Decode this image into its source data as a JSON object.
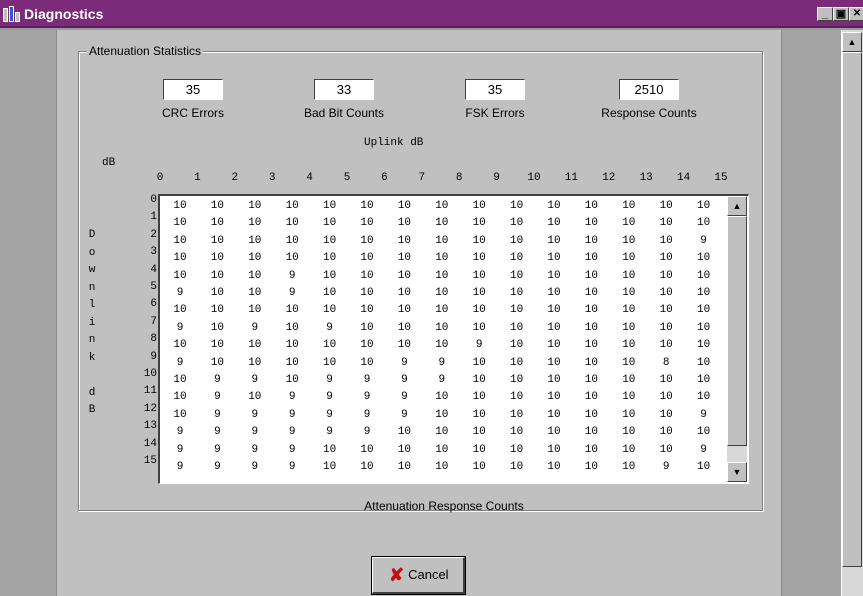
{
  "window": {
    "title": "Diagnostics",
    "minimize": "_",
    "restore": "▣",
    "close": "✕"
  },
  "group": {
    "label": "Attenuation Statistics"
  },
  "stats": [
    {
      "value": "35",
      "label": "CRC Errors"
    },
    {
      "value": "33",
      "label": "Bad Bit Counts"
    },
    {
      "value": "35",
      "label": "FSK Errors"
    },
    {
      "value": "2510",
      "label": "Response Counts"
    }
  ],
  "grid": {
    "uplink_title": "Uplink dB",
    "corner_label": "dB",
    "downlink_title": [
      "D",
      "o",
      "w",
      "n",
      "l",
      "i",
      "n",
      "k",
      "",
      "d",
      "B"
    ],
    "columns": [
      "0",
      "1",
      "2",
      "3",
      "4",
      "5",
      "6",
      "7",
      "8",
      "9",
      "10",
      "11",
      "12",
      "13",
      "14",
      "15"
    ],
    "rows": [
      "0",
      "1",
      "2",
      "3",
      "4",
      "5",
      "6",
      "7",
      "8",
      "9",
      "10",
      "11",
      "12",
      "13",
      "14",
      "15"
    ],
    "cells": [
      [
        "10",
        "10",
        "10",
        "10",
        "10",
        "10",
        "10",
        "10",
        "10",
        "10",
        "10",
        "10",
        "10",
        "10",
        "10"
      ],
      [
        "10",
        "10",
        "10",
        "10",
        "10",
        "10",
        "10",
        "10",
        "10",
        "10",
        "10",
        "10",
        "10",
        "10",
        "10"
      ],
      [
        "10",
        "10",
        "10",
        "10",
        "10",
        "10",
        "10",
        "10",
        "10",
        "10",
        "10",
        "10",
        "10",
        "10",
        "9"
      ],
      [
        "10",
        "10",
        "10",
        "10",
        "10",
        "10",
        "10",
        "10",
        "10",
        "10",
        "10",
        "10",
        "10",
        "10",
        "10"
      ],
      [
        "10",
        "10",
        "10",
        "9",
        "10",
        "10",
        "10",
        "10",
        "10",
        "10",
        "10",
        "10",
        "10",
        "10",
        "10"
      ],
      [
        "9",
        "10",
        "10",
        "9",
        "10",
        "10",
        "10",
        "10",
        "10",
        "10",
        "10",
        "10",
        "10",
        "10",
        "10"
      ],
      [
        "10",
        "10",
        "10",
        "10",
        "10",
        "10",
        "10",
        "10",
        "10",
        "10",
        "10",
        "10",
        "10",
        "10",
        "10"
      ],
      [
        "9",
        "10",
        "9",
        "10",
        "9",
        "10",
        "10",
        "10",
        "10",
        "10",
        "10",
        "10",
        "10",
        "10",
        "10"
      ],
      [
        "10",
        "10",
        "10",
        "10",
        "10",
        "10",
        "10",
        "10",
        "9",
        "10",
        "10",
        "10",
        "10",
        "10",
        "10"
      ],
      [
        "9",
        "10",
        "10",
        "10",
        "10",
        "10",
        "9",
        "9",
        "10",
        "10",
        "10",
        "10",
        "10",
        "8",
        "10"
      ],
      [
        "10",
        "9",
        "9",
        "10",
        "9",
        "9",
        "9",
        "9",
        "10",
        "10",
        "10",
        "10",
        "10",
        "10",
        "10"
      ],
      [
        "10",
        "9",
        "10",
        "9",
        "9",
        "9",
        "9",
        "10",
        "10",
        "10",
        "10",
        "10",
        "10",
        "10",
        "10"
      ],
      [
        "10",
        "9",
        "9",
        "9",
        "9",
        "9",
        "9",
        "10",
        "10",
        "10",
        "10",
        "10",
        "10",
        "10",
        "9"
      ],
      [
        "9",
        "9",
        "9",
        "9",
        "9",
        "9",
        "10",
        "10",
        "10",
        "10",
        "10",
        "10",
        "10",
        "10",
        "10"
      ],
      [
        "9",
        "9",
        "9",
        "9",
        "10",
        "10",
        "10",
        "10",
        "10",
        "10",
        "10",
        "10",
        "10",
        "10",
        "9"
      ],
      [
        "9",
        "9",
        "9",
        "9",
        "10",
        "10",
        "10",
        "10",
        "10",
        "10",
        "10",
        "10",
        "10",
        "9",
        "10"
      ]
    ],
    "footer": "Attenuation Response Counts"
  },
  "cancel": {
    "label": "Cancel",
    "icon": "red-x-icon"
  }
}
